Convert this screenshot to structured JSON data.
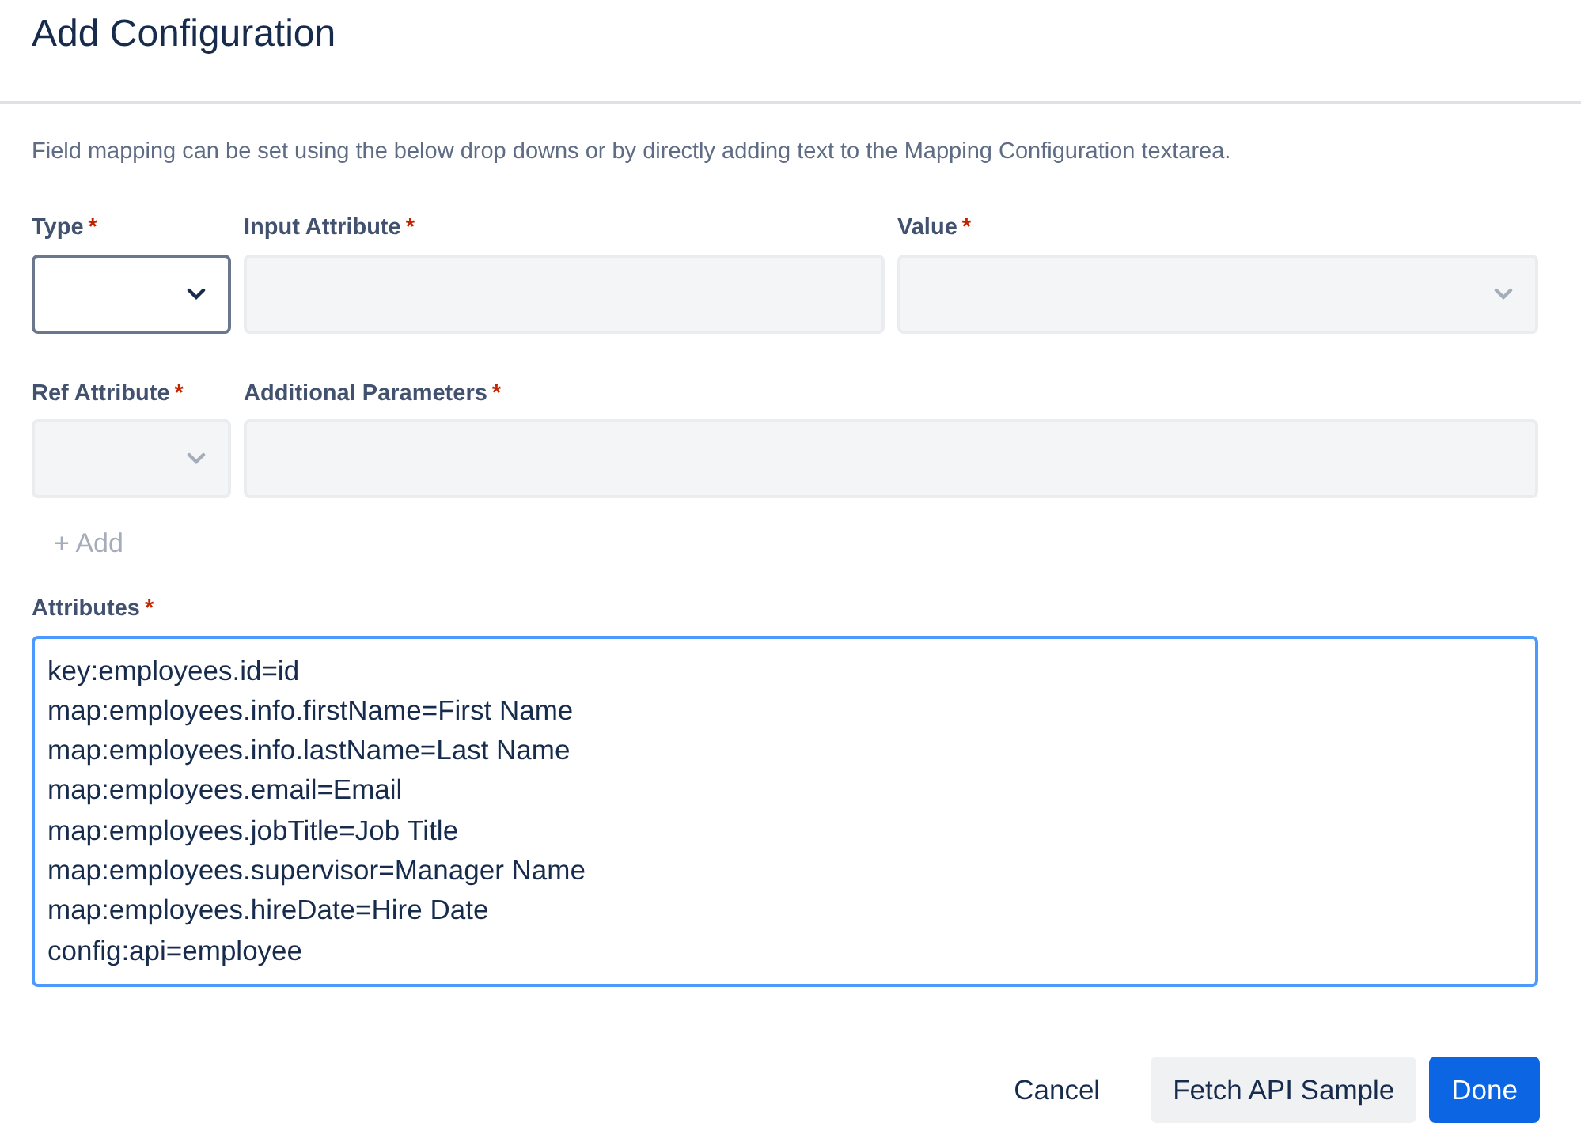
{
  "dialog": {
    "title": "Add Configuration"
  },
  "description": "Field mapping can be set using the below drop downs or by directly adding text to the Mapping Configuration textarea.",
  "field_rows": [
    [
      {
        "kind": "select",
        "label": "Type",
        "required_mark": "*",
        "disabled": false
      },
      {
        "kind": "text",
        "label": "Input Attribute",
        "required_mark": "*",
        "disabled": true
      },
      {
        "kind": "select",
        "label": "Value",
        "required_mark": "*",
        "disabled": true
      }
    ],
    [
      {
        "kind": "select",
        "label": "Ref Attribute",
        "required_mark": "*",
        "disabled": true
      },
      {
        "kind": "text",
        "label": "Additional Parameters",
        "required_mark": "*",
        "disabled": true
      }
    ]
  ],
  "add_button": {
    "label": "+ Add",
    "disabled": true
  },
  "attributes": {
    "label": "Attributes",
    "required_mark": "*",
    "focused": true,
    "value": "key:employees.id=id\nmap:employees.info.firstName=First Name\nmap:employees.info.lastName=Last Name\nmap:employees.email=Email\nmap:employees.jobTitle=Job Title\nmap:employees.supervisor=Manager Name\nmap:employees.hireDate=Hire Date\nconfig:api=employee"
  },
  "buttons": [
    {
      "label": "Cancel",
      "kind": "subtle"
    },
    {
      "label": "Fetch API Sample",
      "kind": "default"
    },
    {
      "label": "Done",
      "kind": "primary"
    }
  ]
}
